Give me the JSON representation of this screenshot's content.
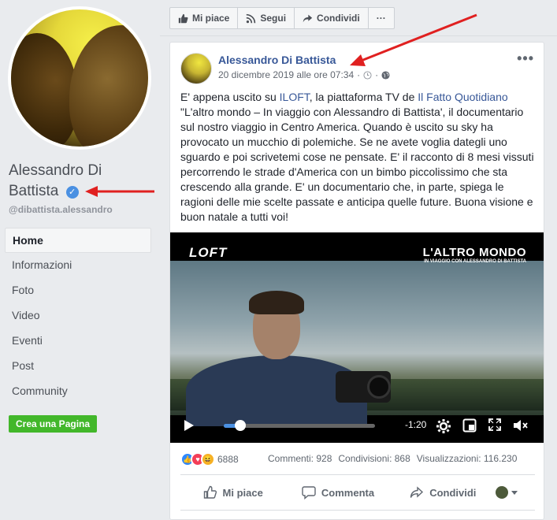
{
  "profile": {
    "name": "Alessandro Di Battista",
    "handle": "@dibattista.alessandro",
    "verified_glyph": "✓"
  },
  "nav": {
    "items": [
      {
        "label": "Home",
        "active": true
      },
      {
        "label": "Informazioni"
      },
      {
        "label": "Foto"
      },
      {
        "label": "Video"
      },
      {
        "label": "Eventi"
      },
      {
        "label": "Post"
      },
      {
        "label": "Community"
      }
    ],
    "create_page": "Crea una Pagina"
  },
  "actionbar": {
    "like": "Mi piace",
    "follow": "Segui",
    "share": "Condividi",
    "more": "···"
  },
  "post": {
    "author": "Alessandro Di Battista",
    "timestamp": "20 dicembre 2019 alle ore 07:34",
    "text_before_link1": "E' appena uscito su ",
    "link1": "ILOFT",
    "text_between": ", la piattaforma TV de ",
    "link2": "Il Fatto Quotidiano",
    "text_after": " \"L'altro mondo – In viaggio con Alessandro di Battista', il documentario sul nostro viaggio in Centro America. Quando è uscito su sky ha provocato un mucchio di polemiche. Se ne avete voglia dategli uno sguardo e poi scrivetemi cose ne pensate. E' il racconto di 8 mesi vissuti percorrendo le strade d'America con un bimbo piccolissimo che sta crescendo alla grande. E' un documentario che, in parte, spiega le ragioni delle mie scelte passate e anticipa quelle future. Buona visione e buon natale a tutti voi!"
  },
  "video": {
    "brand": "LOFT",
    "title": "L'ALTRO MONDO",
    "subtitle": "IN VIAGGIO CON ALESSANDRO DI BATTISTA",
    "time_remaining": "-1:20",
    "progress_fraction": 0.11
  },
  "stats": {
    "reaction_count": "6888",
    "comments": "Commenti: 928",
    "shares": "Condivisioni: 868",
    "views": "Visualizzazioni: 116.230"
  },
  "actions": {
    "like": "Mi piace",
    "comment": "Commenta",
    "share": "Condividi"
  },
  "colors": {
    "link": "#385898",
    "annotation_arrow": "#e02020",
    "create_button": "#42b72a",
    "progress": "#4a90e2"
  }
}
